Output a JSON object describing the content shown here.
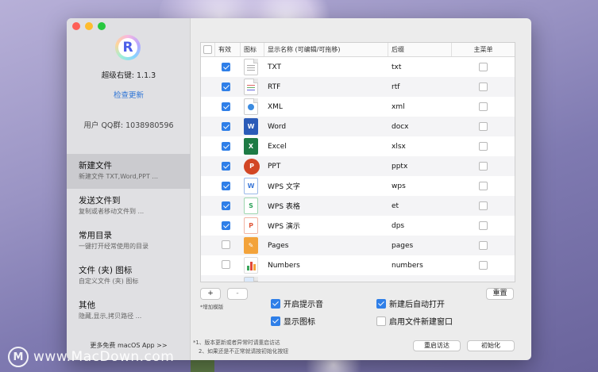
{
  "app": {
    "name": "超级右键: 1.1.3",
    "check_update": "检查更新",
    "qq_group": "用户 QQ群: 1038980596",
    "logo_letter": "R"
  },
  "sidebar": {
    "items": [
      {
        "title": "新建文件",
        "subtitle": "新建文件 TXT,Word,PPT ...",
        "active": true
      },
      {
        "title": "发送文件到",
        "subtitle": "复制或者移动文件到 ...",
        "active": false
      },
      {
        "title": "常用目录",
        "subtitle": "一键打开经常使用的目录",
        "active": false
      },
      {
        "title": "文件 (夹) 图标",
        "subtitle": "自定义文件 (夹) 图标",
        "active": false
      },
      {
        "title": "其他",
        "subtitle": "隐藏,显示,拷贝路径 ...",
        "active": false
      }
    ],
    "more_apps": "更多免费 macOS App >>"
  },
  "table": {
    "headers": {
      "enabled": "有效",
      "icon": "图标",
      "name": "显示名称 (可编辑/可拖移)",
      "ext": "后缀",
      "main_menu": "主菜单"
    },
    "rows": [
      {
        "enabled": true,
        "icon": "txt-file-icon",
        "name": "TXT",
        "ext": "txt",
        "main_menu": false
      },
      {
        "enabled": true,
        "icon": "rtf-file-icon",
        "name": "RTF",
        "ext": "rtf",
        "main_menu": false
      },
      {
        "enabled": true,
        "icon": "xml-file-icon",
        "name": "XML",
        "ext": "xml",
        "main_menu": false
      },
      {
        "enabled": true,
        "icon": "word-icon",
        "name": "Word",
        "ext": "docx",
        "main_menu": false
      },
      {
        "enabled": true,
        "icon": "excel-icon",
        "name": "Excel",
        "ext": "xlsx",
        "main_menu": false
      },
      {
        "enabled": true,
        "icon": "ppt-icon",
        "name": "PPT",
        "ext": "pptx",
        "main_menu": false
      },
      {
        "enabled": true,
        "icon": "wps-writer-icon",
        "name": "WPS 文字",
        "ext": "wps",
        "main_menu": false
      },
      {
        "enabled": true,
        "icon": "wps-sheet-icon",
        "name": "WPS 表格",
        "ext": "et",
        "main_menu": false
      },
      {
        "enabled": true,
        "icon": "wps-slides-icon",
        "name": "WPS 演示",
        "ext": "dps",
        "main_menu": false
      },
      {
        "enabled": false,
        "icon": "pages-icon",
        "name": "Pages",
        "ext": "pages",
        "main_menu": false
      },
      {
        "enabled": false,
        "icon": "numbers-icon",
        "name": "Numbers",
        "ext": "numbers",
        "main_menu": false
      }
    ]
  },
  "controls": {
    "add_label": "+",
    "remove_label": "-",
    "add_template_label": "*增加模版",
    "reset_label": "重置",
    "restart_label": "重启访达",
    "init_label": "初始化"
  },
  "options": {
    "sound": {
      "label": "开启提示音",
      "checked": true
    },
    "auto_open": {
      "label": "新建后自动打开",
      "checked": true
    },
    "show_icon": {
      "label": "显示图标",
      "checked": true
    },
    "new_window": {
      "label": "启用文件新建窗口",
      "checked": false
    }
  },
  "notes": {
    "line1": "*1、版本更新或者异常时请重启访达",
    "line2": "2、如果还是不正常就请按初始化按钮"
  },
  "watermark": {
    "text": "www.MacDown.com",
    "logo_letter": "M"
  },
  "colors": {
    "accent": "#2f7fe8",
    "link": "#2d74d6"
  }
}
